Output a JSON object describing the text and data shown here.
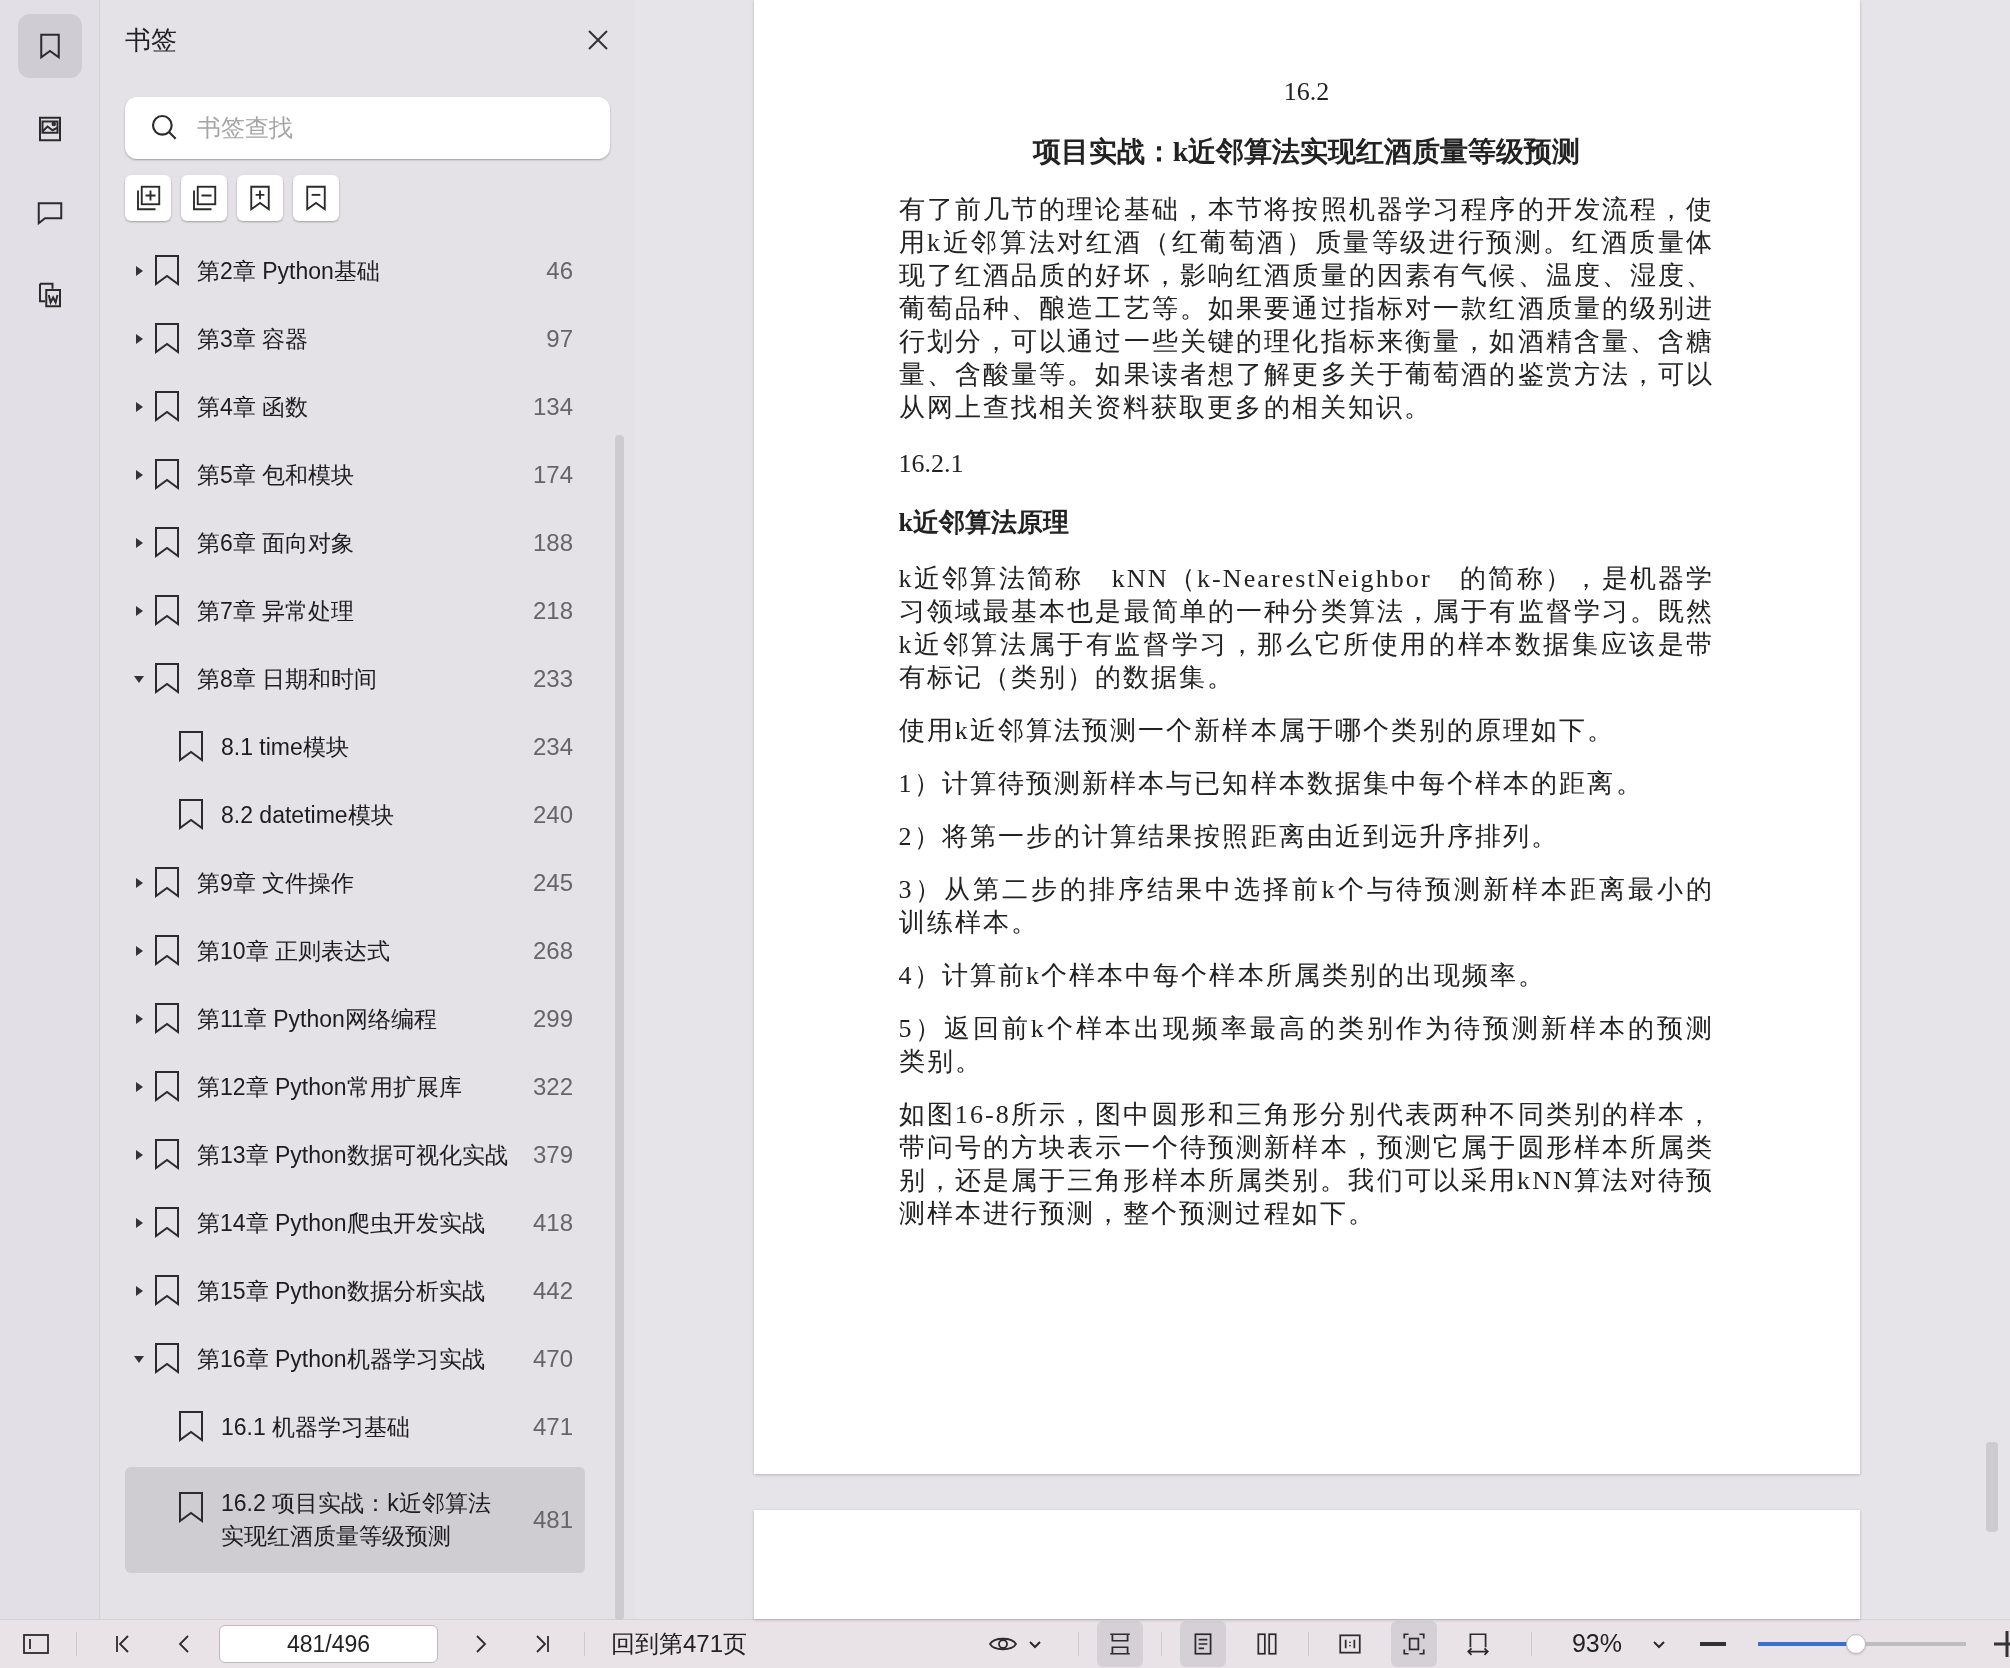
{
  "rail_tabs": [
    {
      "kind": "bookmarks",
      "selected": true
    },
    {
      "kind": "thumbnails",
      "selected": false
    },
    {
      "kind": "comments",
      "selected": false
    },
    {
      "kind": "attachments",
      "selected": false
    }
  ],
  "panel": {
    "title": "书签",
    "search": {
      "placeholder": "书签查找"
    }
  },
  "bookmarks": [
    {
      "label": "第2章 Python基础",
      "page": "46",
      "expanded": false,
      "selected": false
    },
    {
      "label": "第3章 容器",
      "page": "97",
      "expanded": false,
      "selected": false
    },
    {
      "label": "第4章 函数",
      "page": "134",
      "expanded": false,
      "selected": false
    },
    {
      "label": "第5章 包和模块",
      "page": "174",
      "expanded": false,
      "selected": false
    },
    {
      "label": "第6章 面向对象",
      "page": "188",
      "expanded": false,
      "selected": false
    },
    {
      "label": "第7章 异常处理",
      "page": "218",
      "expanded": false,
      "selected": false
    },
    {
      "label": "第8章 日期和时间",
      "page": "233",
      "expanded": true,
      "selected": false,
      "children": [
        {
          "label": "8.1 time模块",
          "page": "234",
          "selected": false
        },
        {
          "label": "8.2 datetime模块",
          "page": "240",
          "selected": false
        }
      ]
    },
    {
      "label": "第9章 文件操作",
      "page": "245",
      "expanded": false,
      "selected": false
    },
    {
      "label": "第10章 正则表达式",
      "page": "268",
      "expanded": false,
      "selected": false
    },
    {
      "label": "第11章 Python网络编程",
      "page": "299",
      "expanded": false,
      "selected": false
    },
    {
      "label": "第12章 Python常用扩展库",
      "page": "322",
      "expanded": false,
      "selected": false
    },
    {
      "label": "第13章 Python数据可视化实战",
      "page": "379",
      "expanded": false,
      "selected": false
    },
    {
      "label": "第14章 Python爬虫开发实战",
      "page": "418",
      "expanded": false,
      "selected": false
    },
    {
      "label": "第15章 Python数据分析实战",
      "page": "442",
      "expanded": false,
      "selected": false
    },
    {
      "label": "第16章 Python机器学习实战",
      "page": "470",
      "expanded": true,
      "selected": false,
      "children": [
        {
          "label": "16.1 机器学习基础",
          "page": "471",
          "selected": false
        },
        {
          "label": "16.2 项目实战：k近邻算法实现红酒质量等级预测",
          "page": "481",
          "selected": true
        }
      ]
    }
  ],
  "document": {
    "blocks": [
      {
        "kind": "number",
        "text": "16.2"
      },
      {
        "kind": "title",
        "text": "项目实战：k近邻算法实现红酒质量等级预测"
      },
      {
        "kind": "paragraph",
        "text": "有了前几节的理论基础，本节将按照机器学习程序的开发流程，使用k近邻算法对红酒（红葡萄酒）质量等级进行预测。红酒质量体现了红酒品质的好坏，影响红酒质量的因素有气候、温度、湿度、葡萄品种、酿造工艺等。如果要通过指标对一款红酒质量的级别进行划分，可以通过一些关键的理化指标来衡量，如酒精含量、含糖量、含酸量等。如果读者想了解更多关于葡萄酒的鉴赏方法，可以从网上查找相关资料获取更多的相关知识。"
      },
      {
        "kind": "subnumber",
        "text": "16.2.1"
      },
      {
        "kind": "subtitle",
        "text": "k近邻算法原理"
      },
      {
        "kind": "paragraph",
        "text": "k近邻算法简称　kNN（k-NearestNeighbor　的简称），是机器学习领域最基本也是最简单的一种分类算法，属于有监督学习。既然　k近邻算法属于有监督学习，那么它所使用的样本数据集应该是带有标记（类别）的数据集。"
      },
      {
        "kind": "paragraph",
        "text": "使用k近邻算法预测一个新样本属于哪个类别的原理如下。"
      },
      {
        "kind": "paragraph",
        "text": "1）计算待预测新样本与已知样本数据集中每个样本的距离。"
      },
      {
        "kind": "paragraph",
        "text": "2）将第一步的计算结果按照距离由近到远升序排列。"
      },
      {
        "kind": "paragraph",
        "text": "3）从第二步的排序结果中选择前k个与待预测新样本距离最小的训练样本。"
      },
      {
        "kind": "paragraph",
        "text": "4）计算前k个样本中每个样本所属类别的出现频率。"
      },
      {
        "kind": "paragraph",
        "text": "5）返回前k个样本出现频率最高的类别作为待预测新样本的预测类别。"
      },
      {
        "kind": "paragraph",
        "text": "如图16-8所示，图中圆形和三角形分别代表两种不同类别的样本，带问号的方块表示一个待预测新样本，预测它属于圆形样本所属类别，还是属于三角形样本所属类别。我们可以采用kNN算法对待预测样本进行预测，整个预测过程如下。"
      }
    ]
  },
  "status_bar": {
    "page_field": "481/496",
    "back_link": "回到第471页",
    "view_buttons": [
      {
        "kind": "continuous",
        "selected": true
      },
      {
        "kind": "single",
        "selected": true
      },
      {
        "kind": "double",
        "selected": false
      },
      {
        "kind": "actual",
        "selected": false
      },
      {
        "kind": "fit",
        "selected": true
      },
      {
        "kind": "width",
        "selected": false
      }
    ],
    "zoom": "93%",
    "zoom_slider": {
      "level": 0.47
    }
  }
}
